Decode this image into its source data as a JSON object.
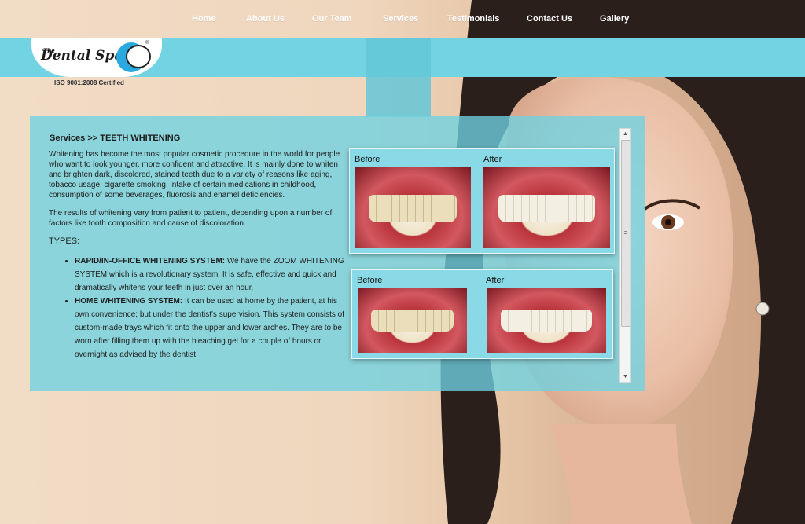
{
  "brand": {
    "logo_the": "The",
    "logo_name": "Dental Spa",
    "registered": "®",
    "certification": "ISO 9001:2008 Certified"
  },
  "nav": {
    "items": [
      {
        "label": "Home"
      },
      {
        "label": "About Us"
      },
      {
        "label": "Our Team"
      },
      {
        "label": "Services",
        "active": true
      },
      {
        "label": "Testimonials"
      },
      {
        "label": "Contact Us"
      },
      {
        "label": "Gallery"
      }
    ]
  },
  "content": {
    "breadcrumb": "Services >> TEETH WHITENING",
    "paragraphs": [
      "Whitening has become the most popular cosmetic procedure in the world for people who want to look younger, more confident and attractive. It is mainly done to whiten and brighten dark, discolored, stained teeth due to a variety of reasons like aging, tobacco usage, cigarette smoking, intake of certain medications in childhood, consumption of some beverages, fluorosis and enamel deficiencies.",
      "The results of whitening vary from patient to patient, depending upon a number of factors like tooth composition and cause of discoloration."
    ],
    "types_heading": "TYPES:",
    "types": [
      {
        "title": "RAPID/IN-OFFICE WHITENING SYSTEM:",
        "text": " We have the ZOOM WHITENING SYSTEM which is a revolutionary system. It is safe, effective and quick and dramatically whitens your teeth in just over an hour."
      },
      {
        "title": "HOME WHITENING SYSTEM:",
        "text": " It can be used at home by the patient, at his own convenience; but under the dentist's supervision. This system consists of custom-made trays which fit onto the upper and lower arches. They are to be worn after filling them up with the bleaching gel for a couple of hours or overnight as advised by the dentist."
      }
    ]
  },
  "gallery": {
    "before_label": "Before",
    "after_label": "After"
  },
  "scrollbar": {
    "up": "▲",
    "down": "▼"
  }
}
